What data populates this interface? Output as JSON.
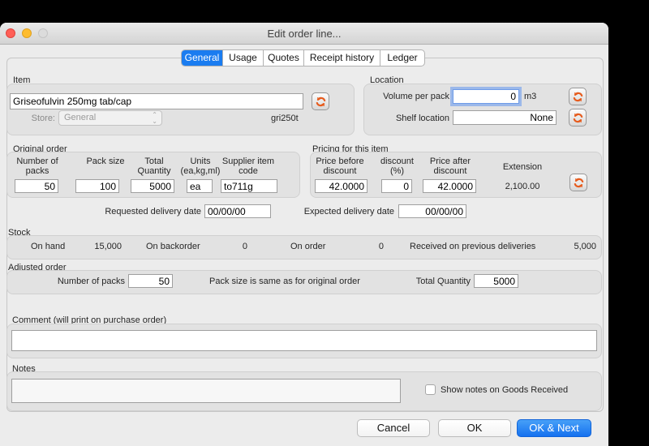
{
  "window": {
    "title": "Edit order line..."
  },
  "tabs": [
    {
      "label": "General",
      "active": true
    },
    {
      "label": "Usage"
    },
    {
      "label": "Quotes"
    },
    {
      "label": "Receipt history"
    },
    {
      "label": "Ledger"
    }
  ],
  "item": {
    "section_label": "Item",
    "name_value": "Griseofulvin 250mg tab/cap",
    "store_label": "Store:",
    "store_value": "General",
    "item_code": "gri250t"
  },
  "location": {
    "section_label": "Location",
    "volume_label": "Volume per pack",
    "volume_value": "0",
    "volume_unit": "m3",
    "shelf_label": "Shelf location",
    "shelf_value": "None"
  },
  "original_order": {
    "section_label": "Original order",
    "fields": [
      {
        "label": "Number of packs",
        "value": "50"
      },
      {
        "label": "Pack size",
        "value": "100"
      },
      {
        "label": "Total Quantity",
        "value": "5000"
      },
      {
        "label": "Units (ea,kg,ml)",
        "value": "ea"
      },
      {
        "label": "Supplier item code",
        "value": "to711g"
      }
    ],
    "requested_label": "Requested delivery date",
    "requested_value": "00/00/00"
  },
  "pricing": {
    "section_label": "Pricing for this item",
    "fields": [
      {
        "label": "Price before discount",
        "value": "42.0000"
      },
      {
        "label": "discount (%)",
        "value": "0"
      },
      {
        "label": "Price after discount",
        "value": "42.0000"
      }
    ],
    "extension_label": "Extension",
    "extension_value": "2,100.00",
    "expected_label": "Expected delivery date",
    "expected_value": "00/00/00"
  },
  "stock": {
    "section_label": "Stock",
    "items": [
      {
        "label": "On hand",
        "value": "15,000"
      },
      {
        "label": "On backorder",
        "value": "0"
      },
      {
        "label": "On order",
        "value": "0"
      },
      {
        "label": "Received on previous deliveries",
        "value": "5,000"
      }
    ]
  },
  "adjusted_order": {
    "section_label": "Adjusted order",
    "packs_label": "Number of packs",
    "packs_value": "50",
    "note": "Pack size is same as for original order",
    "quantity_label": "Total Quantity",
    "quantity_value": "5000"
  },
  "comment": {
    "label": "Comment (will print on purchase order)",
    "value": ""
  },
  "notes": {
    "label": "Notes",
    "value": "",
    "checkbox_label": "Show notes on Goods Received",
    "checkbox_checked": false
  },
  "buttons": {
    "cancel": "Cancel",
    "ok": "OK",
    "ok_next": "OK & Next"
  },
  "colors": {
    "accent_blue": "#1a7cf0",
    "sync_icon_orange": "#e65c1e",
    "close_red": "#ff5f57",
    "minimize_yellow": "#febc2e"
  }
}
